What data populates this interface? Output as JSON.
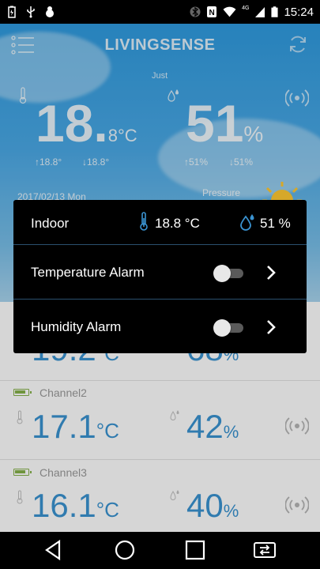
{
  "status_bar": {
    "time": "15:24",
    "network": "4G",
    "icons": [
      "battery-charging-icon",
      "usb-icon",
      "android-debug-icon",
      "bluetooth-icon",
      "nfc-icon",
      "wifi-icon",
      "cell-signal-icon",
      "battery-icon"
    ]
  },
  "header": {
    "app_title": "LIVINGSENSE",
    "menu_icon": "menu-icon",
    "refresh_icon": "refresh-icon"
  },
  "indoor_summary": {
    "updated_label": "Just",
    "temp_int": "18.",
    "temp_dec": "8°C",
    "humidity": "51",
    "humidity_unit": "%",
    "temp_max": "↑18.8°",
    "temp_min": "↓18.8°",
    "hum_max": "↑51%",
    "hum_min": "↓51%",
    "date": "2017/02/13 Mon",
    "pressure_label": "Pressure"
  },
  "channels": [
    {
      "temp": "19.2",
      "temp_unit": "°C",
      "humidity": "68",
      "humidity_unit": "%"
    },
    {
      "name": "Channel2",
      "temp": "17.1",
      "temp_unit": "°C",
      "humidity": "42",
      "humidity_unit": "%"
    },
    {
      "name": "Channel3",
      "temp": "16.1",
      "temp_unit": "°C",
      "humidity": "40",
      "humidity_unit": "%"
    }
  ],
  "dialog": {
    "title": "Indoor",
    "temperature": "18.8 °C",
    "humidity": "51 %",
    "rows": [
      {
        "label": "Temperature Alarm",
        "enabled": false
      },
      {
        "label": "Humidity Alarm",
        "enabled": false
      }
    ]
  },
  "colors": {
    "accent_blue": "#3a93d1",
    "battery_green": "#86b24a",
    "dialog_bg": "#000000",
    "divider": "#2a4f6e"
  },
  "nav_bar": [
    "back-icon",
    "home-icon",
    "recents-icon",
    "screen-switch-icon"
  ]
}
